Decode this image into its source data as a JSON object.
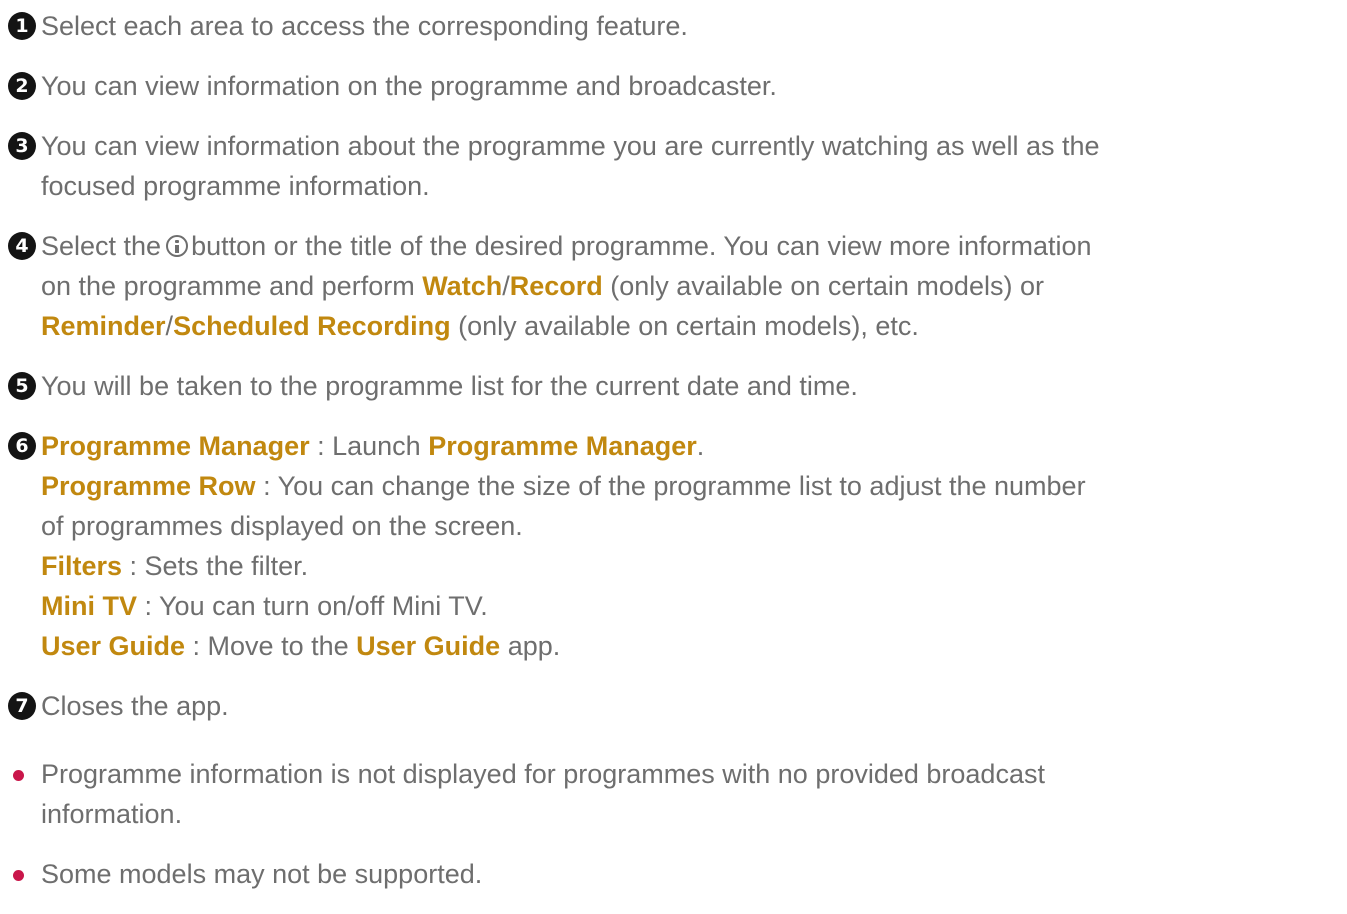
{
  "colors": {
    "text": "#6e6e6e",
    "keyword": "#c1880f",
    "number_badge": "#141414",
    "bullet": "#c9164a"
  },
  "items": [
    {
      "number": "1",
      "text": "Select each area to access the corresponding feature."
    },
    {
      "number": "2",
      "text": "You can view information on the programme and broadcaster."
    },
    {
      "number": "3",
      "line1": "You can view information about the programme you are currently watching as well as the",
      "line2": "focused programme information."
    },
    {
      "number": "4",
      "pre_icon": "Select the",
      "icon": "info-icon",
      "post_icon": "button or the title of the desired programme. You can view more information",
      "line2_pre": "on the programme and perform ",
      "watch": "Watch",
      "slash1": "/",
      "record": "Record",
      "line2_post": " (only available on certain models) or",
      "reminder": "Reminder",
      "slash2": "/",
      "scheduled_recording": "Scheduled Recording",
      "line3_post": " (only available on certain models), etc."
    },
    {
      "number": "5",
      "text": "You will be taken to the programme list for the current date and time."
    },
    {
      "number": "6",
      "programme_manager_label": "Programme Manager",
      "programme_manager_sep": " : Launch ",
      "programme_manager_target": "Programme Manager",
      "programme_manager_end": ".",
      "programme_row_label": "Programme Row",
      "programme_row_text1": " : You can change the size of the programme list to adjust the number",
      "programme_row_text2": "of programmes displayed on the screen.",
      "filters_label": "Filters",
      "filters_text": " : Sets the filter.",
      "mini_tv_label": "Mini TV",
      "mini_tv_text": " : You can turn on/off Mini TV.",
      "user_guide_label": "User Guide",
      "user_guide_sep": " : Move to the ",
      "user_guide_target": "User Guide",
      "user_guide_end": " app."
    },
    {
      "number": "7",
      "text": "Closes the app."
    }
  ],
  "notes": [
    {
      "line1": "Programme information is not displayed for programmes with no provided broadcast",
      "line2": "information."
    },
    {
      "line1": "Some models may not be supported."
    }
  ]
}
